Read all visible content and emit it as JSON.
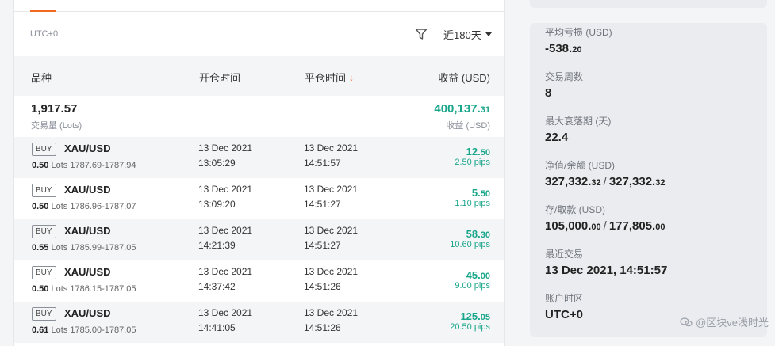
{
  "filter": {
    "timezone": "UTC+0",
    "range": "近180天"
  },
  "table": {
    "headers": {
      "symbol": "品种",
      "open_time": "开仓时间",
      "close_time": "平仓时间",
      "sort_indicator": "↓",
      "profit": "收益 (USD)"
    },
    "summary": {
      "lots": "1,917.57",
      "lots_label": "交易量 (Lots)",
      "profit_main": "400,137.",
      "profit_decimals": "31",
      "profit_label": "收益 (USD)"
    },
    "rows": [
      {
        "side": "BUY",
        "symbol": "XAU/USD",
        "lots": "0.50",
        "lots_unit": "Lots",
        "price_range": "1787.69-1787.94",
        "open_date": "13 Dec 2021",
        "open_time": "13:05:29",
        "close_date": "13 Dec 2021",
        "close_time": "14:51:57",
        "profit_main": "12.",
        "profit_decimals": "50",
        "pips": "2.50 pips"
      },
      {
        "side": "BUY",
        "symbol": "XAU/USD",
        "lots": "0.50",
        "lots_unit": "Lots",
        "price_range": "1786.96-1787.07",
        "open_date": "13 Dec 2021",
        "open_time": "13:09:20",
        "close_date": "13 Dec 2021",
        "close_time": "14:51:27",
        "profit_main": "5.",
        "profit_decimals": "50",
        "pips": "1.10 pips"
      },
      {
        "side": "BUY",
        "symbol": "XAU/USD",
        "lots": "0.55",
        "lots_unit": "Lots",
        "price_range": "1785.99-1787.05",
        "open_date": "13 Dec 2021",
        "open_time": "14:21:39",
        "close_date": "13 Dec 2021",
        "close_time": "14:51:27",
        "profit_main": "58.",
        "profit_decimals": "30",
        "pips": "10.60 pips"
      },
      {
        "side": "BUY",
        "symbol": "XAU/USD",
        "lots": "0.50",
        "lots_unit": "Lots",
        "price_range": "1786.15-1787.05",
        "open_date": "13 Dec 2021",
        "open_time": "14:37:42",
        "close_date": "13 Dec 2021",
        "close_time": "14:51:26",
        "profit_main": "45.",
        "profit_decimals": "00",
        "pips": "9.00 pips"
      },
      {
        "side": "BUY",
        "symbol": "XAU/USD",
        "lots": "0.61",
        "lots_unit": "Lots",
        "price_range": "1785.00-1787.05",
        "open_date": "13 Dec 2021",
        "open_time": "14:41:05",
        "close_date": "13 Dec 2021",
        "close_time": "14:51:26",
        "profit_main": "125.",
        "profit_decimals": "05",
        "pips": "20.50 pips"
      }
    ]
  },
  "stats": {
    "avg_pl": {
      "label": "平均亏损 (USD)",
      "main": "-538.",
      "decimals": "20"
    },
    "trading_weeks": {
      "label": "交易周数",
      "value": "8"
    },
    "max_drawdown": {
      "label": "最大衰落期 (天)",
      "value": "22.4"
    },
    "equity_balance": {
      "label": "净值/余额 (USD)",
      "equity_main": "327,332.",
      "equity_decimals": "32",
      "sep": "/",
      "balance_main": "327,332.",
      "balance_decimals": "32"
    },
    "deposits_withdrawals": {
      "label": "存/取款 (USD)",
      "deposit_main": "105,000.",
      "deposit_decimals": "00",
      "sep": "/",
      "withdraw_main": "177,805.",
      "withdraw_decimals": "00"
    },
    "last_trade": {
      "label": "最近交易",
      "value": "13 Dec 2021, 14:51:57"
    },
    "timezone": {
      "label": "账户时区",
      "value": "UTC+0"
    }
  },
  "watermark": {
    "text": "@区块ve浅时光"
  },
  "colors": {
    "accent": "#f26a21",
    "profit": "#1aa68a",
    "panel_bg": "#ebecef"
  }
}
